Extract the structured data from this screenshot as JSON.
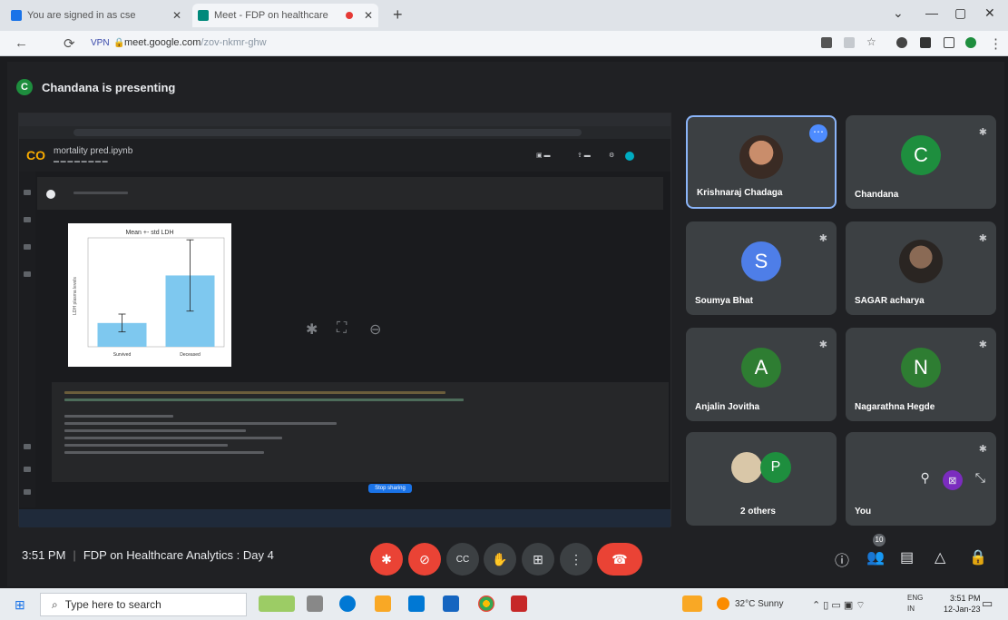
{
  "browser": {
    "tabs": [
      {
        "title": "You are signed in as cse",
        "active": false
      },
      {
        "title": "Meet - FDP on healthcare",
        "active": true
      }
    ],
    "url_domain": "meet.google.com",
    "url_path": "/zov-nkmr-ghw"
  },
  "meet": {
    "presenter_initial": "C",
    "presenting_text": "Chandana is presenting",
    "shared_screen": {
      "notebook_title": "mortality pred.ipynb",
      "chart_title": "Mean +- std LDH",
      "chart_ylabel": "LDH plasma levels",
      "chart_categories": [
        "Survived",
        "Deceased"
      ],
      "sharing_button": "Stop sharing"
    },
    "participants": [
      {
        "name": "Krishnaraj Chadaga",
        "type": "photo",
        "speaking": true
      },
      {
        "name": "Chandana",
        "initial": "C",
        "color": "#1e8e3e"
      },
      {
        "name": "Soumya Bhat",
        "initial": "S",
        "color": "#4e7ee8"
      },
      {
        "name": "SAGAR acharya",
        "type": "photo"
      },
      {
        "name": "Anjalin Jovitha",
        "initial": "A",
        "color": "#2e7d32"
      },
      {
        "name": "Nagarathna Hegde",
        "initial": "N",
        "color": "#2e7d32"
      },
      {
        "name": "2 others",
        "initial": "P",
        "color": "#1e8e3e"
      },
      {
        "name": "You"
      }
    ],
    "time": "3:51 PM",
    "meeting_title": "FDP on Healthcare Analytics : Day 4",
    "people_count": "10"
  },
  "taskbar": {
    "search_placeholder": "Type here to search",
    "weather": "32°C Sunny",
    "lang": "ENG",
    "region": "IN",
    "time": "3:51 PM",
    "date": "12-Jan-23"
  },
  "chart_data": {
    "type": "bar",
    "title": "Mean +- std LDH",
    "categories": [
      "Survived",
      "Deceased"
    ],
    "values": [
      240,
      720
    ],
    "errors": [
      90,
      360
    ],
    "ylabel": "LDH plasma levels",
    "ylim": [
      0,
      1100
    ],
    "color": "#7ec8ef"
  }
}
